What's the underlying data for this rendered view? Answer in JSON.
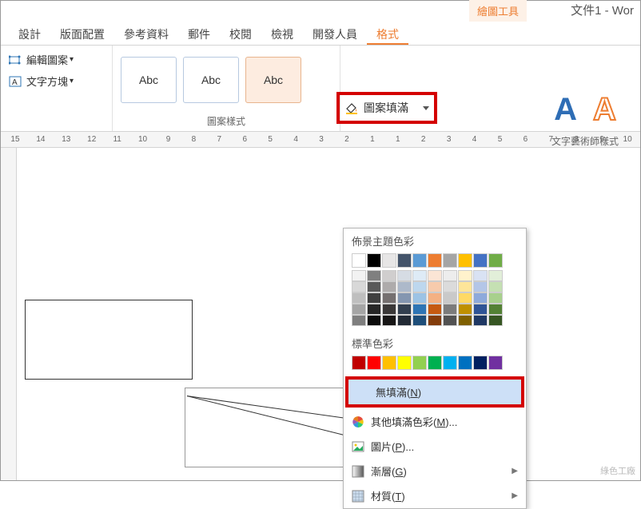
{
  "title": {
    "context_tab": "繪圖工具",
    "document": "文件1 - Wor"
  },
  "tabs": [
    "設計",
    "版面配置",
    "參考資料",
    "郵件",
    "校閱",
    "檢視",
    "開發人員",
    "格式"
  ],
  "active_tab": 7,
  "ribbon": {
    "edit_shape": "編輯圖案",
    "text_box": "文字方塊",
    "shape_gallery": [
      "Abc",
      "Abc",
      "Abc"
    ],
    "shape_group_label": "圖案樣式",
    "shape_fill": "圖案填滿",
    "wordart_label": "文字藝術師樣式"
  },
  "ruler": [
    15,
    14,
    13,
    12,
    11,
    10,
    9,
    8,
    7,
    6,
    5,
    4,
    3,
    2,
    1,
    1,
    2,
    3,
    4,
    5,
    6,
    7,
    8,
    9,
    10
  ],
  "dropdown": {
    "theme_colors": "佈景主題色彩",
    "std_colors": "標準色彩",
    "no_fill": "無填滿",
    "no_fill_key": "N",
    "more_colors": "其他填滿色彩",
    "more_colors_key": "M",
    "picture": "圖片",
    "picture_key": "P",
    "gradient": "漸層",
    "gradient_key": "G",
    "texture": "材質",
    "texture_key": "T"
  },
  "theme_palette": {
    "head": [
      "#ffffff",
      "#000000",
      "#e7e6e6",
      "#44546a",
      "#5b9bd5",
      "#ed7d31",
      "#a5a5a5",
      "#ffc000",
      "#4472c4",
      "#70ad47"
    ],
    "rows": [
      [
        "#f2f2f2",
        "#7f7f7f",
        "#d0cece",
        "#d6dce4",
        "#deebf6",
        "#fbe5d5",
        "#ededed",
        "#fff2cc",
        "#d9e2f3",
        "#e2efd9"
      ],
      [
        "#d8d8d8",
        "#595959",
        "#aeabab",
        "#adb9ca",
        "#bdd7ee",
        "#f7cbac",
        "#dbdbdb",
        "#fee599",
        "#b4c6e7",
        "#c5e0b3"
      ],
      [
        "#bfbfbf",
        "#3f3f3f",
        "#757070",
        "#8496b0",
        "#9cc3e5",
        "#f4b183",
        "#c9c9c9",
        "#ffd965",
        "#8eaadb",
        "#a8d08d"
      ],
      [
        "#a5a5a5",
        "#262626",
        "#3a3838",
        "#323f4f",
        "#2e75b5",
        "#c55a11",
        "#7b7b7b",
        "#bf9000",
        "#2f5496",
        "#538135"
      ],
      [
        "#7f7f7f",
        "#0c0c0c",
        "#171616",
        "#222a35",
        "#1e4e79",
        "#833c0b",
        "#525252",
        "#7f6000",
        "#1f3864",
        "#375623"
      ]
    ]
  },
  "std_palette": [
    "#c00000",
    "#ff0000",
    "#ffc000",
    "#ffff00",
    "#92d050",
    "#00b050",
    "#00b0f0",
    "#0070c0",
    "#002060",
    "#7030a0"
  ],
  "watermark": "綠色工廠"
}
